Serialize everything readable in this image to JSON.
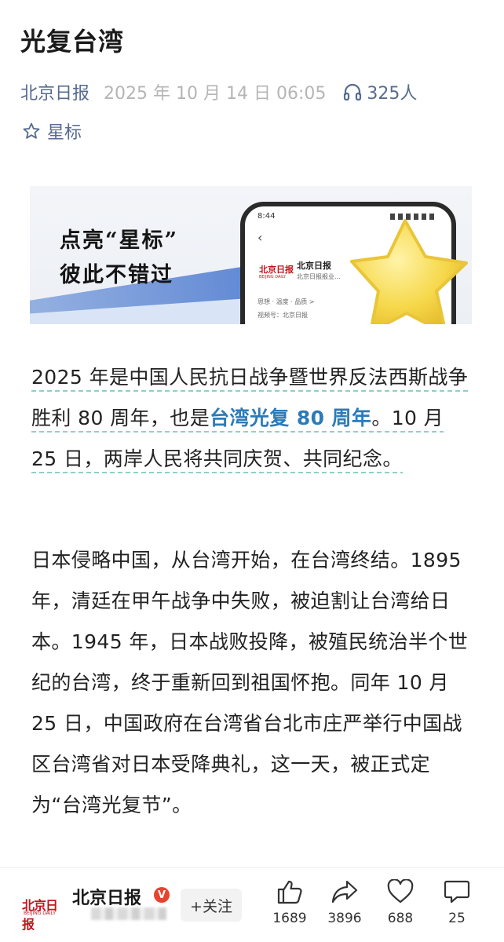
{
  "article": {
    "title": "光复台湾",
    "author": "北京日报",
    "date": "2025 年 10 月 14 日  06:05",
    "listeners": "325人",
    "star_label": "星标"
  },
  "banner": {
    "line1": "点亮“星标”",
    "line2": "彼此不错过",
    "phone_time": "8:44",
    "phone_logo": "北京日报",
    "phone_logo_sub": "BEIJING DAILY",
    "phone_account": "北京日报",
    "phone_desc": "北京日报报业…",
    "phone_tags": "思想 · 温度 · 品质  >",
    "phone_channel": "视频号：北京日报"
  },
  "body": {
    "p1_before": "2025 年是中国人民抗日战争暨世界反法西斯战争胜利 80 周年，也是",
    "p1_link": "台湾光复 80 周年",
    "p1_after": "。10 月 25 日，两岸人民将共同庆贺、共同纪念。",
    "p2": "日本侵略中国，从台湾开始，在台湾终结。1895 年，清廷在甲午战争中失败，被迫割让台湾给日本。1945 年，日本战败投降，被殖民统治半个世纪的台湾，终于重新回到祖国怀抱。同年 10 月 25 日，中国政府在台湾省台北市庄严举行中国战区台湾省对日本受降典礼，这一天，被正式定为“台湾光复节”。"
  },
  "bottom_bar": {
    "avatar_text": "北京日报",
    "avatar_sub": "BEIJING DAILY",
    "account_name": "北京日报",
    "verified_mark": "V",
    "follow_label": "+关注",
    "likes": "1689",
    "shares": "3896",
    "favorites": "688",
    "comments": "25"
  },
  "colors": {
    "meta_blue": "#566b8f",
    "link_blue": "#2b7bb9",
    "underline_teal": "#8fd0c7",
    "verified_red": "#e8432f"
  },
  "icons": {
    "listen": "headphones-icon",
    "star": "star-outline-icon",
    "like": "thumbs-up-icon",
    "share": "share-arrow-icon",
    "favorite": "heart-icon",
    "comment": "comment-bubble-icon"
  }
}
